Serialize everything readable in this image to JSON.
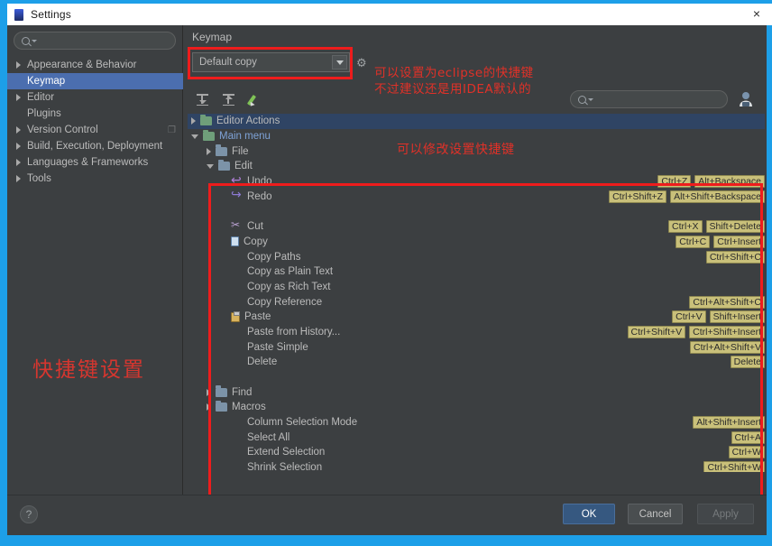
{
  "window": {
    "title": "Settings",
    "close_label": "×",
    "app_icon": "idea-icon"
  },
  "sidebar": {
    "search_placeholder": "",
    "items": [
      {
        "label": "Appearance & Behavior",
        "expandable": true,
        "selected": false
      },
      {
        "label": "Keymap",
        "expandable": false,
        "selected": true
      },
      {
        "label": "Editor",
        "expandable": true,
        "selected": false
      },
      {
        "label": "Plugins",
        "expandable": false,
        "selected": false
      },
      {
        "label": "Version Control",
        "expandable": true,
        "selected": false,
        "trail": "❐"
      },
      {
        "label": "Build, Execution, Deployment",
        "expandable": true,
        "selected": false
      },
      {
        "label": "Languages & Frameworks",
        "expandable": true,
        "selected": false
      },
      {
        "label": "Tools",
        "expandable": true,
        "selected": false
      }
    ]
  },
  "annotations": {
    "left": "快捷键设置",
    "top_line1": "可以设置为eclipse的快捷键",
    "top_line2": "不过建议还是用IDEA默认的",
    "center": "可以修改设置快捷键",
    "color": "#e03128",
    "rect_color": "#ee1c1c"
  },
  "main": {
    "title": "Keymap",
    "keymap_select_value": "Default copy",
    "gear_icon": "gear-icon",
    "toolbar": {
      "expand_all": "expand-all-icon",
      "collapse_all": "collapse-all-icon",
      "edit": "edit-pencil-icon"
    },
    "action_search_placeholder": "",
    "keyboard_shortcut_icon": "keyboard-icon"
  },
  "tree": [
    {
      "label": "Editor Actions",
      "indent": 0,
      "arrow": "right",
      "icon": "folder-green",
      "selected": true,
      "shortcuts": []
    },
    {
      "label": "Main menu",
      "indent": 0,
      "arrow": "down",
      "icon": "folder-green",
      "node": "main",
      "shortcuts": []
    },
    {
      "label": "File",
      "indent": 1,
      "arrow": "right",
      "icon": "folder",
      "shortcuts": []
    },
    {
      "label": "Edit",
      "indent": 1,
      "arrow": "down",
      "icon": "folder",
      "shortcuts": []
    },
    {
      "label": "Undo",
      "indent": 2,
      "arrow": "none",
      "icon": "undo",
      "shortcuts": [
        "Ctrl+Z",
        "Alt+Backspace"
      ]
    },
    {
      "label": "Redo",
      "indent": 2,
      "arrow": "none",
      "icon": "redo",
      "shortcuts": [
        "Ctrl+Shift+Z",
        "Alt+Shift+Backspace"
      ]
    },
    {
      "label": "",
      "indent": 2,
      "separator": true,
      "shortcuts": []
    },
    {
      "label": "Cut",
      "indent": 2,
      "arrow": "none",
      "icon": "cut",
      "shortcuts": [
        "Ctrl+X",
        "Shift+Delete"
      ]
    },
    {
      "label": "Copy",
      "indent": 2,
      "arrow": "none",
      "icon": "copy",
      "shortcuts": [
        "Ctrl+C",
        "Ctrl+Insert"
      ]
    },
    {
      "label": "Copy Paths",
      "indent": 2,
      "arrow": "none",
      "icon": "none",
      "shortcuts": [
        "Ctrl+Shift+C"
      ]
    },
    {
      "label": "Copy as Plain Text",
      "indent": 2,
      "arrow": "none",
      "icon": "none",
      "shortcuts": []
    },
    {
      "label": "Copy as Rich Text",
      "indent": 2,
      "arrow": "none",
      "icon": "none",
      "shortcuts": []
    },
    {
      "label": "Copy Reference",
      "indent": 2,
      "arrow": "none",
      "icon": "none",
      "shortcuts": [
        "Ctrl+Alt+Shift+C"
      ]
    },
    {
      "label": "Paste",
      "indent": 2,
      "arrow": "none",
      "icon": "paste",
      "shortcuts": [
        "Ctrl+V",
        "Shift+Insert"
      ]
    },
    {
      "label": "Paste from History...",
      "indent": 2,
      "arrow": "none",
      "icon": "none",
      "shortcuts": [
        "Ctrl+Shift+V",
        "Ctrl+Shift+Insert"
      ]
    },
    {
      "label": "Paste Simple",
      "indent": 2,
      "arrow": "none",
      "icon": "none",
      "shortcuts": [
        "Ctrl+Alt+Shift+V"
      ]
    },
    {
      "label": "Delete",
      "indent": 2,
      "arrow": "none",
      "icon": "none",
      "shortcuts": [
        "Delete"
      ]
    },
    {
      "label": "",
      "indent": 2,
      "separator": true,
      "shortcuts": []
    },
    {
      "label": "Find",
      "indent": 1,
      "arrow": "right",
      "icon": "folder",
      "shortcuts": []
    },
    {
      "label": "Macros",
      "indent": 1,
      "arrow": "right",
      "icon": "folder",
      "shortcuts": []
    },
    {
      "label": "Column Selection Mode",
      "indent": 2,
      "arrow": "none",
      "icon": "none",
      "shortcuts": [
        "Alt+Shift+Insert"
      ]
    },
    {
      "label": "Select All",
      "indent": 2,
      "arrow": "none",
      "icon": "none",
      "shortcuts": [
        "Ctrl+A"
      ]
    },
    {
      "label": "Extend Selection",
      "indent": 2,
      "arrow": "none",
      "icon": "none",
      "shortcuts": [
        "Ctrl+W"
      ]
    },
    {
      "label": "Shrink Selection",
      "indent": 2,
      "arrow": "none",
      "icon": "none",
      "shortcuts": [
        "Ctrl+Shift+W"
      ]
    },
    {
      "label": "",
      "indent": 2,
      "separator": true,
      "shortcuts": []
    }
  ],
  "footer": {
    "help_label": "?",
    "ok_label": "OK",
    "cancel_label": "Cancel",
    "apply_label": "Apply"
  },
  "colors": {
    "dialog_bg": "#3c3f41",
    "selection_blue": "#4b6eaf",
    "tree_selection": "#2f4464",
    "shortcut_badge": "#c9c07a",
    "accent_outer": "#1d9fe8"
  }
}
